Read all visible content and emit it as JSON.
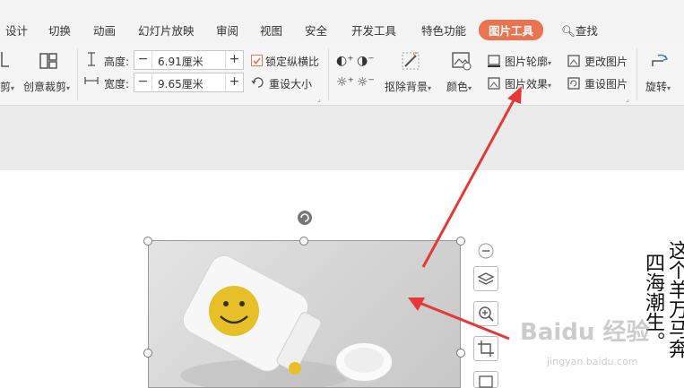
{
  "tabs": [
    "设计",
    "切换",
    "动画",
    "幻灯片放映",
    "审阅",
    "视图",
    "安全",
    "开发工具",
    "特色功能"
  ],
  "active_tab": "图片工具",
  "search_label": "查找",
  "ribbon": {
    "crop_label": "剪",
    "creative_crop_label": "创意裁剪",
    "height_label": "高度:",
    "width_label": "宽度:",
    "height_value": "6.91厘米",
    "width_value": "9.65厘米",
    "lock_ratio_label": "锁定纵横比",
    "reset_size_label": "重设大小",
    "remove_bg_label": "抠除背景",
    "color_label": "颜色",
    "outline_label": "图片轮廓",
    "effects_label": "图片效果",
    "change_label": "更改图片",
    "reset_label": "重设图片",
    "rotate_label": "旋转"
  },
  "slide_text": [
    "这个羊万马奔",
    "四海潮生。"
  ],
  "watermark": "Baidu 经验",
  "watermark_sub": "jingyan.baidu.com",
  "colors": {
    "accent": "#ea7350",
    "arrow": "#e53935"
  }
}
